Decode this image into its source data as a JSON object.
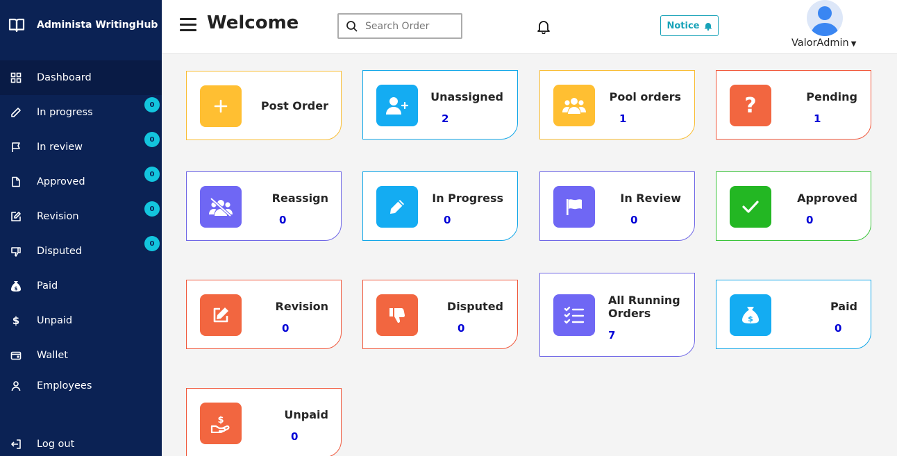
{
  "brand": {
    "name": "Administa WritingHub"
  },
  "sidebar": {
    "items": [
      {
        "label": "Dashboard",
        "icon": "grid-icon",
        "active": true
      },
      {
        "label": "In progress",
        "icon": "pencil-icon",
        "badge": "0"
      },
      {
        "label": "In review",
        "icon": "flag-icon",
        "badge": "0"
      },
      {
        "label": "Approved",
        "icon": "file-icon",
        "badge": "0"
      },
      {
        "label": "Revision",
        "icon": "edit-icon",
        "badge": "0"
      },
      {
        "label": "Disputed",
        "icon": "thumbs-down-icon",
        "badge": "0"
      },
      {
        "label": "Paid",
        "icon": "money-bag-icon"
      },
      {
        "label": "Unpaid",
        "icon": "dollar-icon"
      },
      {
        "label": "Wallet",
        "icon": "wallet-icon"
      },
      {
        "label": "Employees",
        "icon": "user-icon"
      },
      {
        "label": "Log out",
        "icon": "logout-icon"
      }
    ]
  },
  "header": {
    "title": "Welcome",
    "search_placeholder": "Search Order",
    "notice_label": "Notice",
    "user_name": "ValorAdmin"
  },
  "cards": [
    {
      "title": "Post Order",
      "count": null,
      "color": "#ffbf32",
      "icon": "plus-icon"
    },
    {
      "title": "Unassigned",
      "count": "2",
      "color": "#14acf2",
      "icon": "user-plus-icon"
    },
    {
      "title": "Pool orders",
      "count": "1",
      "color": "#ffbf32",
      "icon": "users-icon"
    },
    {
      "title": "Pending",
      "count": "1",
      "color": "#f26640",
      "icon": "question-icon"
    },
    {
      "title": "Reassign",
      "count": "0",
      "color": "#6f67f4",
      "icon": "users-slash-icon"
    },
    {
      "title": "In Progress",
      "count": "0",
      "color": "#14acf2",
      "icon": "pencil-icon"
    },
    {
      "title": "In Review",
      "count": "0",
      "color": "#6f67f4",
      "icon": "flag-icon"
    },
    {
      "title": "Approved",
      "count": "0",
      "color": "#23b723",
      "icon": "check-icon"
    },
    {
      "title": "Revision",
      "count": "0",
      "color": "#f26640",
      "icon": "edit-icon"
    },
    {
      "title": "Disputed",
      "count": "0",
      "color": "#f26640",
      "icon": "thumbs-down-icon"
    },
    {
      "title": "All Running Orders",
      "count": "7",
      "color": "#6f67f4",
      "icon": "list-check-icon"
    },
    {
      "title": "Paid",
      "count": "0",
      "color": "#14acf2",
      "icon": "money-bag-icon"
    },
    {
      "title": "Unpaid",
      "count": "0",
      "color": "#f26640",
      "icon": "hand-dollar-icon"
    }
  ]
}
